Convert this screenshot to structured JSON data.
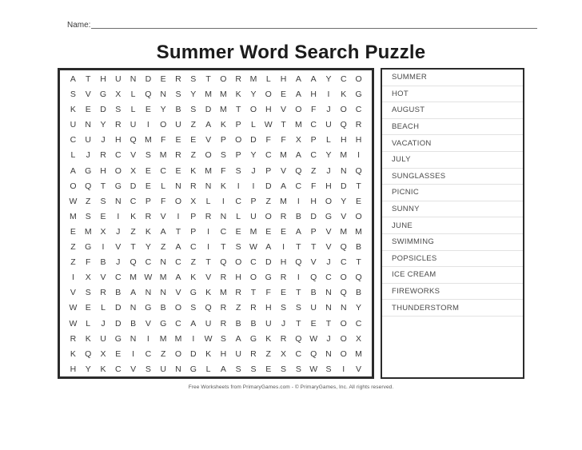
{
  "header": {
    "name_label": "Name:",
    "title": "Summer Word Search Puzzle"
  },
  "puzzle": {
    "columns": 20,
    "rows": 20,
    "grid": [
      [
        "A",
        "T",
        "H",
        "U",
        "N",
        "D",
        "E",
        "R",
        "S",
        "T",
        "O",
        "R",
        "M",
        "L",
        "H",
        "A",
        "A",
        "Y",
        "C",
        "O"
      ],
      [
        "S",
        "V",
        "G",
        "X",
        "L",
        "Q",
        "N",
        "S",
        "Y",
        "M",
        "M",
        "K",
        "Y",
        "O",
        "E",
        "A",
        "H",
        "I",
        "K",
        "G"
      ],
      [
        "K",
        "E",
        "D",
        "S",
        "L",
        "E",
        "Y",
        "B",
        "S",
        "D",
        "M",
        "T",
        "O",
        "H",
        "V",
        "O",
        "F",
        "J",
        "O",
        "C"
      ],
      [
        "U",
        "N",
        "Y",
        "R",
        "U",
        "I",
        "O",
        "U",
        "Z",
        "A",
        "K",
        "P",
        "L",
        "W",
        "T",
        "M",
        "C",
        "U",
        "Q",
        "R"
      ],
      [
        "C",
        "U",
        "J",
        "H",
        "Q",
        "M",
        "F",
        "E",
        "E",
        "V",
        "P",
        "O",
        "D",
        "F",
        "F",
        "X",
        "P",
        "L",
        "H",
        "H"
      ],
      [
        "L",
        "J",
        "R",
        "C",
        "V",
        "S",
        "M",
        "R",
        "Z",
        "O",
        "S",
        "P",
        "Y",
        "C",
        "M",
        "A",
        "C",
        "Y",
        "M",
        "I"
      ],
      [
        "A",
        "G",
        "H",
        "O",
        "X",
        "E",
        "C",
        "E",
        "K",
        "M",
        "F",
        "S",
        "J",
        "P",
        "V",
        "Q",
        "Z",
        "J",
        "N",
        "Q"
      ],
      [
        "O",
        "Q",
        "T",
        "G",
        "D",
        "E",
        "L",
        "N",
        "R",
        "N",
        "K",
        "I",
        "I",
        "D",
        "A",
        "C",
        "F",
        "H",
        "D",
        "T"
      ],
      [
        "W",
        "Z",
        "S",
        "N",
        "C",
        "P",
        "F",
        "O",
        "X",
        "L",
        "I",
        "C",
        "P",
        "Z",
        "M",
        "I",
        "H",
        "O",
        "Y",
        "E"
      ],
      [
        "M",
        "S",
        "E",
        "I",
        "K",
        "R",
        "V",
        "I",
        "P",
        "R",
        "N",
        "L",
        "U",
        "O",
        "R",
        "B",
        "D",
        "G",
        "V",
        "O"
      ],
      [
        "E",
        "M",
        "X",
        "J",
        "Z",
        "K",
        "A",
        "T",
        "P",
        "I",
        "C",
        "E",
        "M",
        "E",
        "E",
        "A",
        "P",
        "V",
        "M",
        "M"
      ],
      [
        "Z",
        "G",
        "I",
        "V",
        "T",
        "Y",
        "Z",
        "A",
        "C",
        "I",
        "T",
        "S",
        "W",
        "A",
        "I",
        "T",
        "T",
        "V",
        "Q",
        "B"
      ],
      [
        "Z",
        "F",
        "B",
        "J",
        "Q",
        "C",
        "N",
        "C",
        "Z",
        "T",
        "Q",
        "O",
        "C",
        "D",
        "H",
        "Q",
        "V",
        "J",
        "C",
        "T"
      ],
      [
        "I",
        "X",
        "V",
        "C",
        "M",
        "W",
        "M",
        "A",
        "K",
        "V",
        "R",
        "H",
        "O",
        "G",
        "R",
        "I",
        "Q",
        "C",
        "O",
        "Q"
      ],
      [
        "V",
        "S",
        "R",
        "B",
        "A",
        "N",
        "N",
        "V",
        "G",
        "K",
        "M",
        "R",
        "T",
        "F",
        "E",
        "T",
        "B",
        "N",
        "Q",
        "B"
      ],
      [
        "W",
        "E",
        "L",
        "D",
        "N",
        "G",
        "B",
        "O",
        "S",
        "Q",
        "R",
        "Z",
        "R",
        "H",
        "S",
        "S",
        "U",
        "N",
        "N",
        "Y"
      ],
      [
        "W",
        "L",
        "J",
        "D",
        "B",
        "V",
        "G",
        "C",
        "A",
        "U",
        "R",
        "B",
        "B",
        "U",
        "J",
        "T",
        "E",
        "T",
        "O",
        "C"
      ],
      [
        "R",
        "K",
        "U",
        "G",
        "N",
        "I",
        "M",
        "M",
        "I",
        "W",
        "S",
        "A",
        "G",
        "K",
        "R",
        "Q",
        "W",
        "J",
        "O",
        "X"
      ],
      [
        "K",
        "Q",
        "X",
        "E",
        "I",
        "C",
        "Z",
        "O",
        "D",
        "K",
        "H",
        "U",
        "R",
        "Z",
        "X",
        "C",
        "Q",
        "N",
        "O",
        "M"
      ],
      [
        "H",
        "Y",
        "K",
        "C",
        "V",
        "S",
        "U",
        "N",
        "G",
        "L",
        "A",
        "S",
        "S",
        "E",
        "S",
        "S",
        "W",
        "S",
        "I",
        "V"
      ]
    ]
  },
  "word_list": {
    "words": [
      "SUMMER",
      "HOT",
      "AUGUST",
      "BEACH",
      "VACATION",
      "JULY",
      "SUNGLASSES",
      "PICNIC",
      "SUNNY",
      "JUNE",
      "SWIMMING",
      "POPSICLES",
      "ICE CREAM",
      "FIREWORKS",
      "THUNDERSTORM"
    ]
  },
  "footer": {
    "credit": "Free Worksheets from PrimaryGames.com - © PrimaryGames, Inc. All rights reserved."
  }
}
